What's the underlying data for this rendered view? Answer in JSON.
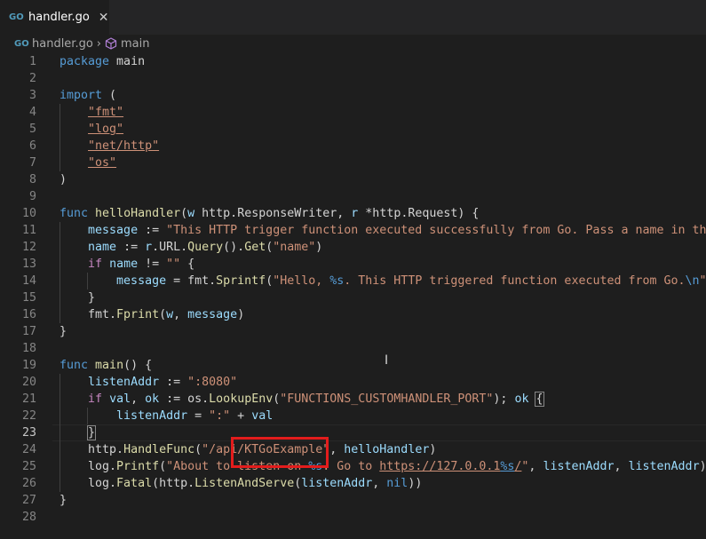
{
  "tab": {
    "label": "handler.go",
    "icon": "go-file-icon",
    "close": "✕"
  },
  "breadcrumb": {
    "file": "handler.go",
    "symbol": "main"
  },
  "current_line": 23,
  "lines": [
    {
      "n": "1",
      "t": [
        [
          "kw",
          "package"
        ],
        [
          "txt",
          " main"
        ]
      ]
    },
    {
      "n": "2",
      "t": []
    },
    {
      "n": "3",
      "t": [
        [
          "kw",
          "import"
        ],
        [
          "txt",
          " ("
        ]
      ]
    },
    {
      "n": "4",
      "t": [
        [
          "txt",
          "    "
        ],
        [
          "str ul",
          "\"fmt\""
        ]
      ]
    },
    {
      "n": "5",
      "t": [
        [
          "txt",
          "    "
        ],
        [
          "str ul",
          "\"log\""
        ]
      ]
    },
    {
      "n": "6",
      "t": [
        [
          "txt",
          "    "
        ],
        [
          "str ul",
          "\"net/http\""
        ]
      ]
    },
    {
      "n": "7",
      "t": [
        [
          "txt",
          "    "
        ],
        [
          "str ul",
          "\"os\""
        ]
      ]
    },
    {
      "n": "8",
      "t": [
        [
          "txt",
          ")"
        ]
      ]
    },
    {
      "n": "9",
      "t": []
    },
    {
      "n": "10",
      "t": [
        [
          "kw",
          "func"
        ],
        [
          "txt",
          " "
        ],
        [
          "fn",
          "helloHandler"
        ],
        [
          "txt",
          "("
        ],
        [
          "var",
          "w"
        ],
        [
          "txt",
          " http.ResponseWriter, "
        ],
        [
          "var",
          "r"
        ],
        [
          "txt",
          " *http.Request) {"
        ]
      ]
    },
    {
      "n": "11",
      "t": [
        [
          "txt",
          "    "
        ],
        [
          "var",
          "message"
        ],
        [
          "txt",
          " := "
        ],
        [
          "str",
          "\"This HTTP trigger function executed successfully from Go. Pass a name in the qu"
        ]
      ]
    },
    {
      "n": "12",
      "t": [
        [
          "txt",
          "    "
        ],
        [
          "var",
          "name"
        ],
        [
          "txt",
          " := "
        ],
        [
          "var",
          "r"
        ],
        [
          "txt",
          ".URL."
        ],
        [
          "fn",
          "Query"
        ],
        [
          "txt",
          "()."
        ],
        [
          "fn",
          "Get"
        ],
        [
          "txt",
          "("
        ],
        [
          "str",
          "\"name\""
        ],
        [
          "txt",
          ")"
        ]
      ]
    },
    {
      "n": "13",
      "t": [
        [
          "txt",
          "    "
        ],
        [
          "ctl",
          "if"
        ],
        [
          "txt",
          " "
        ],
        [
          "var",
          "name"
        ],
        [
          "txt",
          " != "
        ],
        [
          "str",
          "\"\""
        ],
        [
          "txt",
          " {"
        ]
      ]
    },
    {
      "n": "14",
      "t": [
        [
          "txt",
          "        "
        ],
        [
          "var",
          "message"
        ],
        [
          "txt",
          " = fmt."
        ],
        [
          "fn",
          "Sprintf"
        ],
        [
          "txt",
          "("
        ],
        [
          "str",
          "\"Hello, "
        ],
        [
          "fmt",
          "%s"
        ],
        [
          "str",
          ". This HTTP triggered function executed from Go."
        ],
        [
          "fmt",
          "\\n"
        ],
        [
          "str",
          "\""
        ],
        [
          "txt",
          ", na"
        ]
      ]
    },
    {
      "n": "15",
      "t": [
        [
          "txt",
          "    }"
        ]
      ]
    },
    {
      "n": "16",
      "t": [
        [
          "txt",
          "    fmt."
        ],
        [
          "fn",
          "Fprint"
        ],
        [
          "txt",
          "("
        ],
        [
          "var",
          "w"
        ],
        [
          "txt",
          ", "
        ],
        [
          "var",
          "message"
        ],
        [
          "txt",
          ")"
        ]
      ]
    },
    {
      "n": "17",
      "t": [
        [
          "txt",
          "}"
        ]
      ]
    },
    {
      "n": "18",
      "t": []
    },
    {
      "n": "19",
      "t": [
        [
          "kw",
          "func"
        ],
        [
          "txt",
          " "
        ],
        [
          "fn",
          "main"
        ],
        [
          "txt",
          "() {"
        ]
      ]
    },
    {
      "n": "20",
      "t": [
        [
          "txt",
          "    "
        ],
        [
          "var",
          "listenAddr"
        ],
        [
          "txt",
          " := "
        ],
        [
          "str",
          "\":8080\""
        ]
      ]
    },
    {
      "n": "21",
      "t": [
        [
          "txt",
          "    "
        ],
        [
          "ctl",
          "if"
        ],
        [
          "txt",
          " "
        ],
        [
          "var",
          "val"
        ],
        [
          "txt",
          ", "
        ],
        [
          "var",
          "ok"
        ],
        [
          "txt",
          " := os."
        ],
        [
          "fn",
          "LookupEnv"
        ],
        [
          "txt",
          "("
        ],
        [
          "str",
          "\"FUNCTIONS_CUSTOMHANDLER_PORT\""
        ],
        [
          "txt",
          "); "
        ],
        [
          "var",
          "ok"
        ],
        [
          "txt",
          " "
        ],
        [
          "txt bracket-box",
          "{"
        ]
      ]
    },
    {
      "n": "22",
      "t": [
        [
          "txt",
          "        "
        ],
        [
          "var",
          "listenAddr"
        ],
        [
          "txt",
          " = "
        ],
        [
          "str",
          "\":\""
        ],
        [
          "txt",
          " + "
        ],
        [
          "var",
          "val"
        ]
      ]
    },
    {
      "n": "23",
      "t": [
        [
          "txt",
          "    "
        ],
        [
          "txt bracket-box",
          "}"
        ]
      ]
    },
    {
      "n": "24",
      "t": [
        [
          "txt",
          "    http."
        ],
        [
          "fn",
          "HandleFunc"
        ],
        [
          "txt",
          "("
        ],
        [
          "str",
          "\"/api/KTGoExample\""
        ],
        [
          "txt",
          ", "
        ],
        [
          "var",
          "helloHandler"
        ],
        [
          "txt",
          ")"
        ]
      ]
    },
    {
      "n": "25",
      "t": [
        [
          "txt",
          "    log."
        ],
        [
          "fn",
          "Printf"
        ],
        [
          "txt",
          "("
        ],
        [
          "str",
          "\"About to listen on "
        ],
        [
          "fmt",
          "%s"
        ],
        [
          "str",
          ". Go to "
        ],
        [
          "str link",
          "https://127.0.0.1"
        ],
        [
          "fmt link",
          "%s"
        ],
        [
          "str link",
          "/"
        ],
        [
          "str",
          "\""
        ],
        [
          "txt",
          ", "
        ],
        [
          "var",
          "listenAddr"
        ],
        [
          "txt",
          ", "
        ],
        [
          "var",
          "listenAddr"
        ],
        [
          "txt",
          ")"
        ]
      ]
    },
    {
      "n": "26",
      "t": [
        [
          "txt",
          "    log."
        ],
        [
          "fn",
          "Fatal"
        ],
        [
          "txt",
          "(http."
        ],
        [
          "fn",
          "ListenAndServe"
        ],
        [
          "txt",
          "("
        ],
        [
          "var",
          "listenAddr"
        ],
        [
          "txt",
          ", "
        ],
        [
          "kw",
          "nil"
        ],
        [
          "txt",
          "))"
        ]
      ]
    },
    {
      "n": "27",
      "t": [
        [
          "txt",
          "}"
        ]
      ]
    },
    {
      "n": "28",
      "t": []
    }
  ],
  "guides": [
    {
      "lines": [
        4,
        5,
        6,
        7
      ],
      "indent": 1
    },
    {
      "lines": [
        11,
        12,
        13,
        14,
        15,
        16
      ],
      "indent": 1
    },
    {
      "lines": [
        14
      ],
      "indent": 2
    },
    {
      "lines": [
        20,
        21,
        22,
        23,
        24,
        25,
        26
      ],
      "indent": 1
    },
    {
      "lines": [
        22
      ],
      "indent": 2
    }
  ],
  "annotation": {
    "color": "#e31c1c"
  }
}
